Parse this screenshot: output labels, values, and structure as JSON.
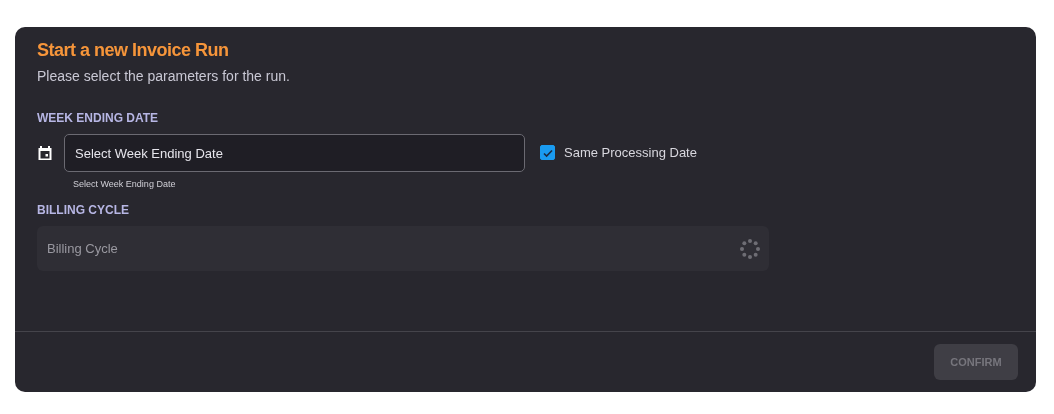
{
  "dialog": {
    "title": "Start a new Invoice Run",
    "subtitle": "Please select the parameters for the run."
  },
  "week_ending_date": {
    "label": "WEEK ENDING DATE",
    "placeholder": "Select Week Ending Date",
    "hint": "Select Week Ending Date"
  },
  "same_processing_date": {
    "label": "Same Processing Date",
    "checked": true
  },
  "billing_cycle": {
    "label": "BILLING CYCLE",
    "placeholder": "Billing Cycle",
    "loading": true
  },
  "confirm_button": {
    "label": "CONFIRM",
    "disabled": true
  }
}
